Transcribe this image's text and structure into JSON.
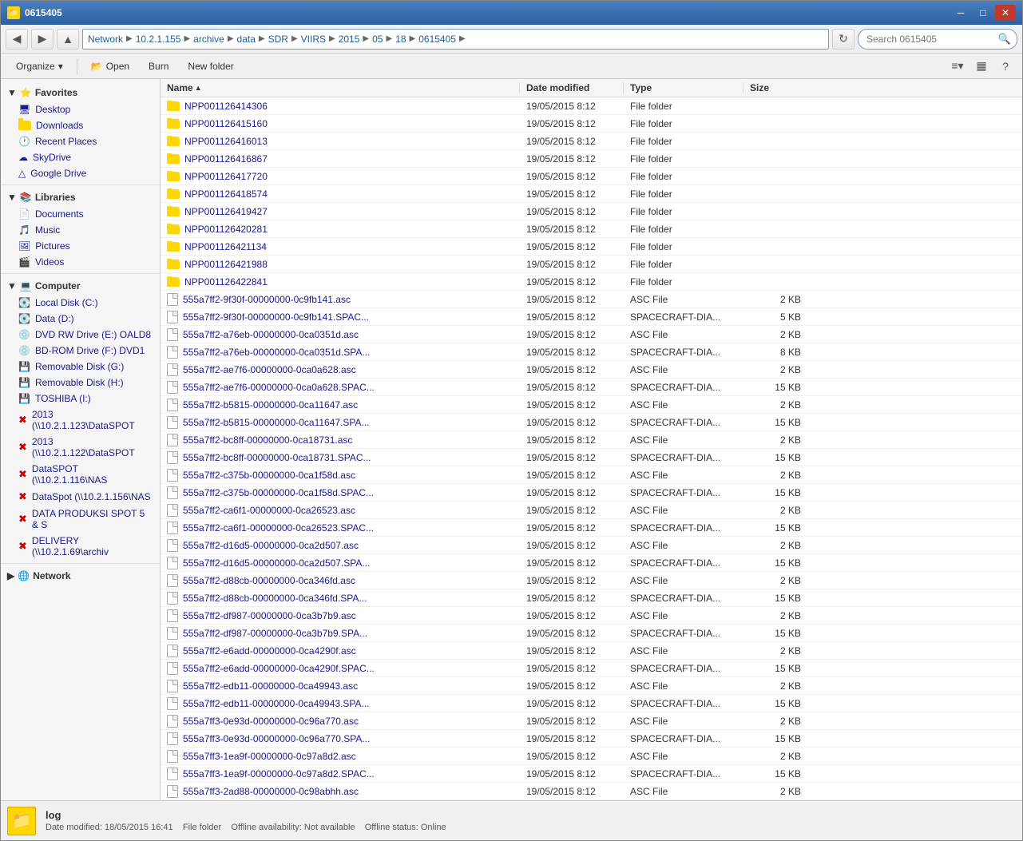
{
  "window": {
    "title": "0615405",
    "icon": "📁"
  },
  "address": {
    "back_tooltip": "Back",
    "forward_tooltip": "Forward",
    "up_tooltip": "Up",
    "path_segments": [
      "Network",
      "10.2.1.155",
      "archive",
      "data",
      "SDR",
      "VIIRS",
      "2015",
      "05",
      "18",
      "0615405"
    ],
    "refresh_tooltip": "Refresh",
    "search_placeholder": "Search 0615405",
    "search_value": ""
  },
  "toolbar": {
    "organize": "Organize",
    "open": "Open",
    "burn": "Burn",
    "new_folder": "New folder",
    "views_tooltip": "Change your view",
    "help_tooltip": "Help"
  },
  "sidebar": {
    "favorites_header": "Favorites",
    "favorites_items": [
      {
        "label": "Desktop",
        "icon": "desktop"
      },
      {
        "label": "Downloads",
        "icon": "folder"
      },
      {
        "label": "Recent Places",
        "icon": "recent"
      },
      {
        "label": "SkyDrive",
        "icon": "sky"
      },
      {
        "label": "Google Drive",
        "icon": "gdrive"
      }
    ],
    "libraries_header": "Libraries",
    "libraries_items": [
      {
        "label": "Documents",
        "icon": "docs"
      },
      {
        "label": "Music",
        "icon": "music"
      },
      {
        "label": "Pictures",
        "icon": "pics"
      },
      {
        "label": "Videos",
        "icon": "video"
      }
    ],
    "computer_header": "Computer",
    "computer_items": [
      {
        "label": "Local Disk (C:)",
        "icon": "disk"
      },
      {
        "label": "Data (D:)",
        "icon": "disk"
      },
      {
        "label": "DVD RW Drive (E:) OALD8",
        "icon": "dvd"
      },
      {
        "label": "BD-ROM Drive (F:) DVD1",
        "icon": "bd"
      },
      {
        "label": "Removable Disk (G:)",
        "icon": "removable"
      },
      {
        "label": "Removable Disk (H:)",
        "icon": "removable"
      },
      {
        "label": "TOSHIBA (I:)",
        "icon": "removable"
      },
      {
        "label": "2013 (\\\\10.2.1.123\\DataSPOT",
        "icon": "network_drive"
      },
      {
        "label": "2013 (\\\\10.2.1.122\\DataSPOT",
        "icon": "network_drive"
      },
      {
        "label": "DataSPOT (\\\\10.2.1.116\\NAS",
        "icon": "network_drive"
      },
      {
        "label": "DataSpot (\\\\10.2.1.156\\NAS",
        "icon": "network_drive"
      },
      {
        "label": "DATA PRODUKSI SPOT 5 & S",
        "icon": "network_drive"
      },
      {
        "label": "DELIVERY (\\\\10.2.1.69\\archiv",
        "icon": "network_drive"
      }
    ],
    "network_header": "Network",
    "network_selected": true
  },
  "columns": {
    "name": "Name",
    "date_modified": "Date modified",
    "type": "Type",
    "size": "Size"
  },
  "files": [
    {
      "name": "NPP001126414306",
      "date": "19/05/2015 8:12",
      "type": "File folder",
      "size": "",
      "is_folder": true
    },
    {
      "name": "NPP001126415160",
      "date": "19/05/2015 8:12",
      "type": "File folder",
      "size": "",
      "is_folder": true
    },
    {
      "name": "NPP001126416013",
      "date": "19/05/2015 8:12",
      "type": "File folder",
      "size": "",
      "is_folder": true
    },
    {
      "name": "NPP001126416867",
      "date": "19/05/2015 8:12",
      "type": "File folder",
      "size": "",
      "is_folder": true
    },
    {
      "name": "NPP001126417720",
      "date": "19/05/2015 8:12",
      "type": "File folder",
      "size": "",
      "is_folder": true
    },
    {
      "name": "NPP001126418574",
      "date": "19/05/2015 8:12",
      "type": "File folder",
      "size": "",
      "is_folder": true
    },
    {
      "name": "NPP001126419427",
      "date": "19/05/2015 8:12",
      "type": "File folder",
      "size": "",
      "is_folder": true
    },
    {
      "name": "NPP001126420281",
      "date": "19/05/2015 8:12",
      "type": "File folder",
      "size": "",
      "is_folder": true
    },
    {
      "name": "NPP001126421134",
      "date": "19/05/2015 8:12",
      "type": "File folder",
      "size": "",
      "is_folder": true
    },
    {
      "name": "NPP001126421988",
      "date": "19/05/2015 8:12",
      "type": "File folder",
      "size": "",
      "is_folder": true
    },
    {
      "name": "NPP001126422841",
      "date": "19/05/2015 8:12",
      "type": "File folder",
      "size": "",
      "is_folder": true
    },
    {
      "name": "555a7ff2-9f30f-00000000-0c9fb141.asc",
      "date": "19/05/2015 8:12",
      "type": "ASC File",
      "size": "2 KB",
      "is_folder": false
    },
    {
      "name": "555a7ff2-9f30f-00000000-0c9fb141.SPAC...",
      "date": "19/05/2015 8:12",
      "type": "SPACECRAFT-DIA...",
      "size": "5 KB",
      "is_folder": false
    },
    {
      "name": "555a7ff2-a76eb-00000000-0ca0351d.asc",
      "date": "19/05/2015 8:12",
      "type": "ASC File",
      "size": "2 KB",
      "is_folder": false
    },
    {
      "name": "555a7ff2-a76eb-00000000-0ca0351d.SPA...",
      "date": "19/05/2015 8:12",
      "type": "SPACECRAFT-DIA...",
      "size": "8 KB",
      "is_folder": false
    },
    {
      "name": "555a7ff2-ae7f6-00000000-0ca0a628.asc",
      "date": "19/05/2015 8:12",
      "type": "ASC File",
      "size": "2 KB",
      "is_folder": false
    },
    {
      "name": "555a7ff2-ae7f6-00000000-0ca0a628.SPAC...",
      "date": "19/05/2015 8:12",
      "type": "SPACECRAFT-DIA...",
      "size": "15 KB",
      "is_folder": false
    },
    {
      "name": "555a7ff2-b5815-00000000-0ca11647.asc",
      "date": "19/05/2015 8:12",
      "type": "ASC File",
      "size": "2 KB",
      "is_folder": false
    },
    {
      "name": "555a7ff2-b5815-00000000-0ca11647.SPA...",
      "date": "19/05/2015 8:12",
      "type": "SPACECRAFT-DIA...",
      "size": "15 KB",
      "is_folder": false
    },
    {
      "name": "555a7ff2-bc8ff-00000000-0ca18731.asc",
      "date": "19/05/2015 8:12",
      "type": "ASC File",
      "size": "2 KB",
      "is_folder": false
    },
    {
      "name": "555a7ff2-bc8ff-00000000-0ca18731.SPAC...",
      "date": "19/05/2015 8:12",
      "type": "SPACECRAFT-DIA...",
      "size": "15 KB",
      "is_folder": false
    },
    {
      "name": "555a7ff2-c375b-00000000-0ca1f58d.asc",
      "date": "19/05/2015 8:12",
      "type": "ASC File",
      "size": "2 KB",
      "is_folder": false
    },
    {
      "name": "555a7ff2-c375b-00000000-0ca1f58d.SPAC...",
      "date": "19/05/2015 8:12",
      "type": "SPACECRAFT-DIA...",
      "size": "15 KB",
      "is_folder": false
    },
    {
      "name": "555a7ff2-ca6f1-00000000-0ca26523.asc",
      "date": "19/05/2015 8:12",
      "type": "ASC File",
      "size": "2 KB",
      "is_folder": false
    },
    {
      "name": "555a7ff2-ca6f1-00000000-0ca26523.SPAC...",
      "date": "19/05/2015 8:12",
      "type": "SPACECRAFT-DIA...",
      "size": "15 KB",
      "is_folder": false
    },
    {
      "name": "555a7ff2-d16d5-00000000-0ca2d507.asc",
      "date": "19/05/2015 8:12",
      "type": "ASC File",
      "size": "2 KB",
      "is_folder": false
    },
    {
      "name": "555a7ff2-d16d5-00000000-0ca2d507.SPA...",
      "date": "19/05/2015 8:12",
      "type": "SPACECRAFT-DIA...",
      "size": "15 KB",
      "is_folder": false
    },
    {
      "name": "555a7ff2-d88cb-00000000-0ca346fd.asc",
      "date": "19/05/2015 8:12",
      "type": "ASC File",
      "size": "2 KB",
      "is_folder": false
    },
    {
      "name": "555a7ff2-d88cb-00000000-0ca346fd.SPA...",
      "date": "19/05/2015 8:12",
      "type": "SPACECRAFT-DIA...",
      "size": "15 KB",
      "is_folder": false
    },
    {
      "name": "555a7ff2-df987-00000000-0ca3b7b9.asc",
      "date": "19/05/2015 8:12",
      "type": "ASC File",
      "size": "2 KB",
      "is_folder": false
    },
    {
      "name": "555a7ff2-df987-00000000-0ca3b7b9.SPA...",
      "date": "19/05/2015 8:12",
      "type": "SPACECRAFT-DIA...",
      "size": "15 KB",
      "is_folder": false
    },
    {
      "name": "555a7ff2-e6add-00000000-0ca4290f.asc",
      "date": "19/05/2015 8:12",
      "type": "ASC File",
      "size": "2 KB",
      "is_folder": false
    },
    {
      "name": "555a7ff2-e6add-00000000-0ca4290f.SPAC...",
      "date": "19/05/2015 8:12",
      "type": "SPACECRAFT-DIA...",
      "size": "15 KB",
      "is_folder": false
    },
    {
      "name": "555a7ff2-edb11-00000000-0ca49943.asc",
      "date": "19/05/2015 8:12",
      "type": "ASC File",
      "size": "2 KB",
      "is_folder": false
    },
    {
      "name": "555a7ff2-edb11-00000000-0ca49943.SPA...",
      "date": "19/05/2015 8:12",
      "type": "SPACECRAFT-DIA...",
      "size": "15 KB",
      "is_folder": false
    },
    {
      "name": "555a7ff3-0e93d-00000000-0c96a770.asc",
      "date": "19/05/2015 8:12",
      "type": "ASC File",
      "size": "2 KB",
      "is_folder": false
    },
    {
      "name": "555a7ff3-0e93d-00000000-0c96a770.SPA...",
      "date": "19/05/2015 8:12",
      "type": "SPACECRAFT-DIA...",
      "size": "15 KB",
      "is_folder": false
    },
    {
      "name": "555a7ff3-1ea9f-00000000-0c97a8d2.asc",
      "date": "19/05/2015 8:12",
      "type": "ASC File",
      "size": "2 KB",
      "is_folder": false
    },
    {
      "name": "555a7ff3-1ea9f-00000000-0c97a8d2.SPAC...",
      "date": "19/05/2015 8:12",
      "type": "SPACECRAFT-DIA...",
      "size": "15 KB",
      "is_folder": false
    },
    {
      "name": "555a7ff3-2ad88-00000000-0c98abhh.asc",
      "date": "19/05/2015 8:12",
      "type": "ASC File",
      "size": "2 KB",
      "is_folder": false
    }
  ],
  "status": {
    "name": "log",
    "date_label": "Date modified:",
    "date_value": "18/05/2015 16:41",
    "type_label": "File folder",
    "offline_label": "Offline availability:",
    "offline_value": "Not available",
    "offline_status_label": "Offline status:",
    "offline_status_value": "Online"
  }
}
